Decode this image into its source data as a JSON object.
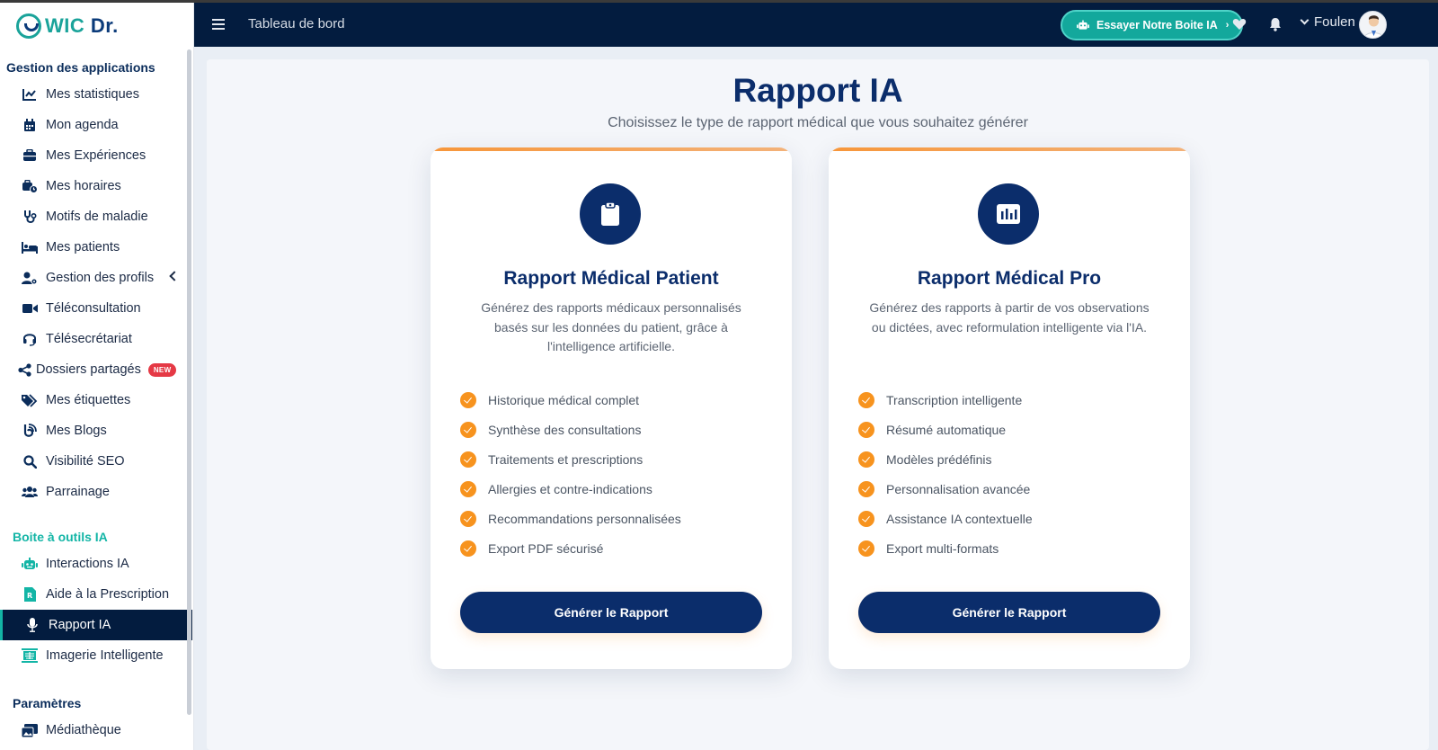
{
  "brand": {
    "part1": "WIC",
    "part2": "Dr.",
    "teal": "#13b5a6",
    "navy": "#0b2d6b"
  },
  "header": {
    "breadcrumb": "Tableau de bord",
    "try_button": "Essayer Notre Boite IA",
    "user_name": "Foulen"
  },
  "sidebar": {
    "section1": "Gestion des applications",
    "items1": [
      {
        "label": "Mes statistiques",
        "icon": "chart-line-icon"
      },
      {
        "label": "Mon agenda",
        "icon": "calendar-icon"
      },
      {
        "label": "Mes Expériences",
        "icon": "briefcase-icon"
      },
      {
        "label": "Mes horaires",
        "icon": "business-time-icon"
      },
      {
        "label": "Motifs de maladie",
        "icon": "stethoscope-icon"
      },
      {
        "label": "Mes patients",
        "icon": "bed-icon"
      },
      {
        "label": "Gestion des profils",
        "icon": "user-cog-icon"
      },
      {
        "label": "Téléconsultation",
        "icon": "video-icon"
      },
      {
        "label": "Télésecrétariat",
        "icon": "headset-icon"
      },
      {
        "label": "Dossiers partagés",
        "icon": "share-icon",
        "badge": "NEW"
      },
      {
        "label": "Mes étiquettes",
        "icon": "tags-icon"
      },
      {
        "label": "Mes Blogs",
        "icon": "blog-icon"
      },
      {
        "label": "Visibilité SEO",
        "icon": "search-icon"
      },
      {
        "label": "Parrainage",
        "icon": "users-icon"
      }
    ],
    "section2": "Boite à outils IA",
    "items2": [
      {
        "label": "Interactions IA",
        "icon": "robot-icon"
      },
      {
        "label": "Aide à la Prescription",
        "icon": "prescription-icon"
      },
      {
        "label": "Rapport IA",
        "icon": "microphone-icon",
        "active": true
      },
      {
        "label": "Imagerie Intelligente",
        "icon": "x-ray-icon"
      }
    ],
    "section3": "Paramètres",
    "items3": [
      {
        "label": "Médiathèque",
        "icon": "photo-video-icon"
      }
    ]
  },
  "main": {
    "title": "Rapport IA",
    "subtitle": "Choisissez le type de rapport médical que vous souhaitez générer",
    "cards": [
      {
        "icon": "clipboard-icon",
        "title": "Rapport Médical Patient",
        "description": "Générez des rapports médicaux personnalisés basés sur les données du patient, grâce à l'intelligence artificielle.",
        "features": [
          "Historique médical complet",
          "Synthèse des consultations",
          "Traitements et prescriptions",
          "Allergies et contre-indications",
          "Recommandations personnalisées",
          "Export PDF sécurisé"
        ],
        "button": "Générer le Rapport"
      },
      {
        "icon": "chart-bar-icon",
        "title": "Rapport Médical Pro",
        "description": "Générez des rapports à partir de vos observations ou dictées, avec reformulation intelligente via l'IA.",
        "features": [
          "Transcription intelligente",
          "Résumé automatique",
          "Modèles prédéfinis",
          "Personnalisation avancée",
          "Assistance IA contextuelle",
          "Export multi-formats"
        ],
        "button": "Générer le Rapport"
      }
    ]
  }
}
